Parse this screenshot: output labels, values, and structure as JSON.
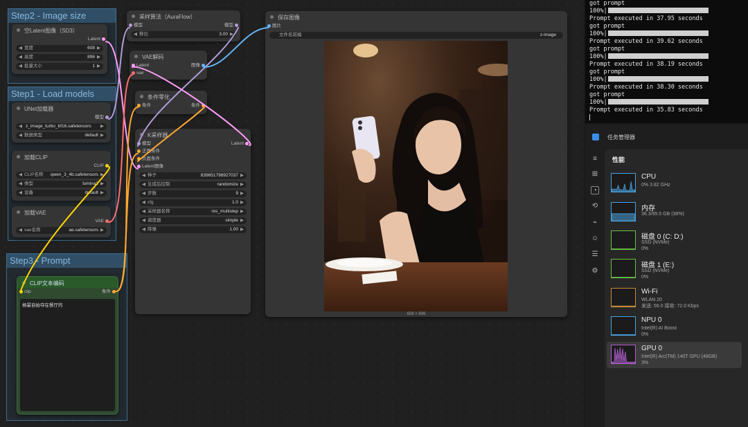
{
  "groups": {
    "step2": "Step2 - Image size",
    "step1": "Step1 - Load models",
    "step3": "Step3 - Prompt"
  },
  "latent_node": {
    "title": "空Latent图像（SD3）",
    "output": "Latent",
    "width_label": "宽度",
    "width_value": "608",
    "height_label": "高度",
    "height_value": "896",
    "batch_label": "批量大小",
    "batch_value": "1"
  },
  "unet_node": {
    "title": "UNet加载器",
    "output": "模型",
    "model_value": "z_image_turbo_bf16.safetensors",
    "dtype_label": "数据类型",
    "dtype_value": "default"
  },
  "clip_loader_node": {
    "title": "加载CLIP",
    "output": "CLIP",
    "name_label": "CLIP名称",
    "name_value": "qwen_3_4b.safetensors",
    "type_label": "类型",
    "type_value": "lumina2",
    "device_label": "设备",
    "device_value": "default"
  },
  "vae_loader_node": {
    "title": "加载VAE",
    "output": "VAE",
    "name_label": "vae名称",
    "name_value": "ae.safetensors"
  },
  "clip_text_node": {
    "title": "CLIP文本编码",
    "input": "clip",
    "output": "条件",
    "prompt": "杨幂自拍夺在餐厅的"
  },
  "sampling_node": {
    "title": "采样算法（AuraFlow）",
    "input": "模型",
    "output": "模型",
    "shift_label": "移位",
    "shift_value": "3.00"
  },
  "vae_decode_node": {
    "title": "VAE解码",
    "input1": "Latent",
    "input2": "vae",
    "output": "图像"
  },
  "cond_zero_node": {
    "title": "条件零化",
    "input": "条件",
    "output": "条件"
  },
  "ksampler_node": {
    "title": "K采样器",
    "in_model": "模型",
    "in_pos": "正面条件",
    "in_neg": "负面条件",
    "in_latent": "Latent图像",
    "output": "Latent",
    "seed_label": "种子",
    "seed_value": "839651798927037",
    "control_label": "生成后控制",
    "control_value": "randomize",
    "steps_label": "步数",
    "steps_value": "9",
    "cfg_label": "cfg",
    "cfg_value": "1.0",
    "sampler_label": "采样器名称",
    "sampler_value": "res_multistep",
    "scheduler_label": "调度器",
    "scheduler_value": "simple",
    "denoise_label": "降噪",
    "denoise_value": "1.00"
  },
  "save_node": {
    "title": "保存图像",
    "input": "图片",
    "prefix_label": "文件名前缀",
    "prefix_value": "z-image",
    "size_caption": "608 × 896"
  },
  "console": {
    "lines": [
      {
        "kind": "text",
        "text": "got prompt"
      },
      {
        "kind": "bar",
        "text": "100%|"
      },
      {
        "kind": "text",
        "text": "Prompt executed in 37.95 seconds"
      },
      {
        "kind": "text",
        "text": "got prompt"
      },
      {
        "kind": "bar",
        "text": "100%|"
      },
      {
        "kind": "text",
        "text": "Prompt executed in 39.62 seconds"
      },
      {
        "kind": "text",
        "text": "got prompt"
      },
      {
        "kind": "bar",
        "text": "100%|"
      },
      {
        "kind": "text",
        "text": "Prompt executed in 38.19 seconds"
      },
      {
        "kind": "text",
        "text": "got prompt"
      },
      {
        "kind": "bar",
        "text": "100%|"
      },
      {
        "kind": "text",
        "text": "Prompt executed in 38.30 seconds"
      },
      {
        "kind": "text",
        "text": "got prompt"
      },
      {
        "kind": "bar",
        "text": "100%|"
      },
      {
        "kind": "text",
        "text": "Prompt executed in 35.83 seconds"
      }
    ]
  },
  "taskmgr": {
    "title": "任务管理器",
    "section": "性能",
    "items": [
      {
        "name": "CPU",
        "sub1": "0% 3.82 GHz",
        "sub2": "",
        "color": "#4aa3df"
      },
      {
        "name": "内存",
        "sub1": "36.3/95.5 GB (38%)",
        "sub2": "",
        "color": "#4aa3df"
      },
      {
        "name": "磁盘 0 (C: D:)",
        "sub1": "SSD (NVMe)",
        "sub2": "0%",
        "color": "#6cbf4a"
      },
      {
        "name": "磁盘 1 (E:)",
        "sub1": "SSD (NVMe)",
        "sub2": "0%",
        "color": "#6cbf4a"
      },
      {
        "name": "Wi-Fi",
        "sub1": "WLAN 20",
        "sub2": "发送: 56.0  接收: 72.0 Kbps",
        "color": "#c58a3a"
      },
      {
        "name": "NPU 0",
        "sub1": "Intel(R) AI Boost",
        "sub2": "0%",
        "color": "#4aa3df"
      },
      {
        "name": "GPU 0",
        "sub1": "Intel(R) Arc(TM) 140T GPU (48GB)",
        "sub2": "3%",
        "color": "#b15fd0"
      }
    ]
  }
}
